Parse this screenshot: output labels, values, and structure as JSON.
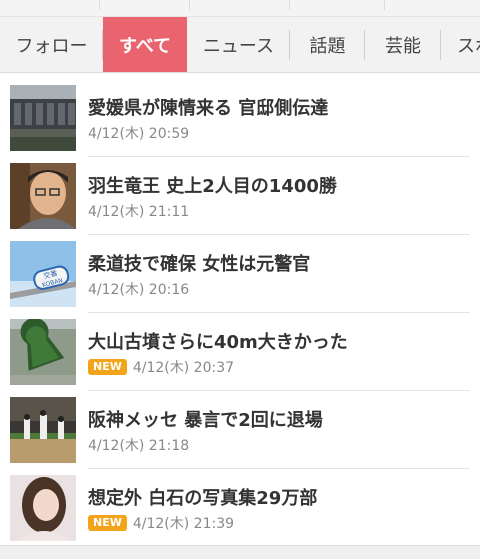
{
  "tabs": [
    {
      "label": "フォロー",
      "active": false
    },
    {
      "label": "すべて",
      "active": true
    },
    {
      "label": "ニュース",
      "active": false
    },
    {
      "label": "話題",
      "active": false
    },
    {
      "label": "芸能",
      "active": false
    },
    {
      "label": "スポ",
      "active": false
    }
  ],
  "colors": {
    "accent": "#ea6470",
    "new_badge": "#f2a51a"
  },
  "articles": [
    {
      "title": "愛媛県が陳情来る 官邸側伝達",
      "time": "4/12(木) 20:59",
      "is_new": false,
      "thumb_icon": "government-building-icon"
    },
    {
      "title": "羽生竜王 史上2人目の1400勝",
      "time": "4/12(木) 21:11",
      "is_new": false,
      "thumb_icon": "portrait-icon"
    },
    {
      "title": "柔道技で確保 女性は元警官",
      "time": "4/12(木) 20:16",
      "is_new": false,
      "thumb_icon": "koban-sign-icon",
      "thumb_text": [
        "交番",
        "KOBAN"
      ]
    },
    {
      "title": "大山古墳さらに40m大きかった",
      "time": "4/12(木) 20:37",
      "is_new": true,
      "badge": "NEW",
      "thumb_icon": "keyhole-tomb-icon"
    },
    {
      "title": "阪神メッセ 暴言で2回に退場",
      "time": "4/12(木) 21:18",
      "is_new": false,
      "thumb_icon": "baseball-field-icon"
    },
    {
      "title": "想定外 白石の写真集29万部",
      "time": "4/12(木) 21:39",
      "is_new": true,
      "badge": "NEW",
      "thumb_icon": "portrait-icon"
    }
  ]
}
